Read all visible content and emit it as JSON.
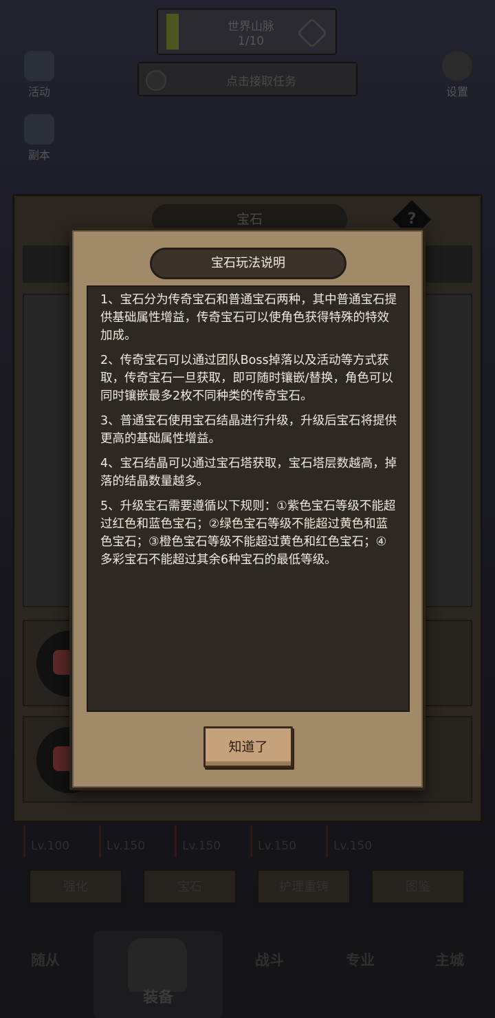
{
  "background": {
    "top_box": {
      "title": "世界山脉",
      "progress": "1/10"
    },
    "task_bar": {
      "text": "点击接取任务"
    },
    "left_buttons": [
      {
        "label": "活动",
        "icon": "star-icon"
      },
      {
        "label": "副本",
        "icon": "gate-icon"
      }
    ],
    "right_button": {
      "label": "设置",
      "icon": "gear-icon"
    },
    "gem_panel": {
      "title": "宝石",
      "help": "?"
    },
    "levels": [
      "Lv.100",
      "Lv.150",
      "Lv.150",
      "Lv.150",
      "Lv.150"
    ],
    "tabs": [
      "强化",
      "宝石",
      "护理重铸",
      "图鉴"
    ],
    "bottom_nav": [
      "随从",
      "装备",
      "战斗",
      "专业",
      "主城"
    ]
  },
  "modal": {
    "title": "宝石玩法说明",
    "paragraphs": [
      "1、宝石分为传奇宝石和普通宝石两种，其中普通宝石提供基础属性增益，传奇宝石可以使角色获得特殊的特效加成。",
      "2、传奇宝石可以通过团队Boss掉落以及活动等方式获取，传奇宝石一旦获取，即可随时镶嵌/替换，角色可以同时镶嵌最多2枚不同种类的传奇宝石。",
      "3、普通宝石使用宝石结晶进行升级，升级后宝石将提供更高的基础属性增益。",
      "4、宝石结晶可以通过宝石塔获取，宝石塔层数越高，掉落的结晶数量越多。",
      "5、升级宝石需要遵循以下规则：①紫色宝石等级不能超过红色和蓝色宝石；②绿色宝石等级不能超过黄色和蓝色宝石；③橙色宝石等级不能超过黄色和红色宝石；④多彩宝石不能超过其余6种宝石的最低等级。"
    ],
    "ok_label": "知道了"
  }
}
